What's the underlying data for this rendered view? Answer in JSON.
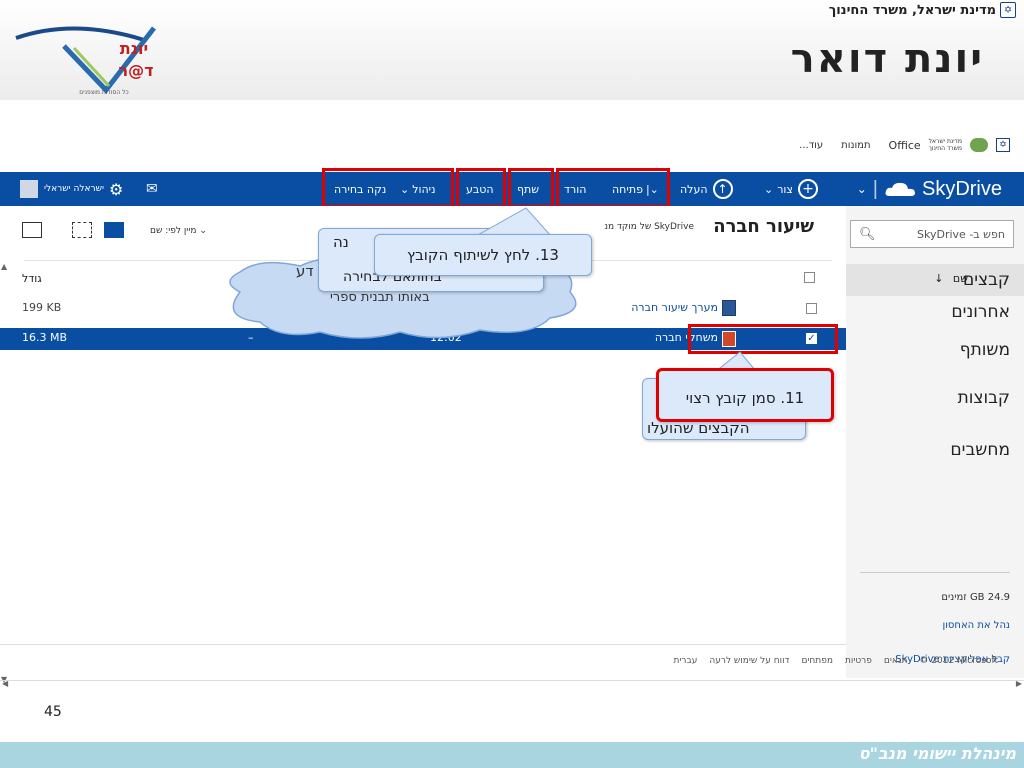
{
  "header": {
    "ministry": "מדינת ישראל, משרד החינוך",
    "title": "יונת דואר",
    "logo_line1": "יונת",
    "logo_line2": "ד@ר",
    "logo_tagline": "כל הסודות מוצפנים"
  },
  "subbar": {
    "mini_ministry_1": "מדינת ישראל",
    "mini_ministry_2": "משרד החינוך",
    "office": "Office",
    "photos": "תמונות",
    "more": "עוד..."
  },
  "topnav": {
    "brand": "SkyDrive",
    "create": "צור",
    "upload": "העלה",
    "open": "פתיחה",
    "download": "הורד",
    "share": "שתף",
    "embed": "הטבע",
    "manage": "ניהול",
    "clear": "נקה בחירה",
    "user": "ישראלה ישראלי"
  },
  "sidebar": {
    "search_placeholder": "חפש ב- SkyDrive",
    "items": [
      {
        "label": "קבצים"
      },
      {
        "label": "אחרונים"
      },
      {
        "label": "משותף"
      },
      {
        "label": "קבוצות"
      },
      {
        "label": "מחשבים"
      }
    ],
    "storage": "24.9 GB זמינים",
    "manage_storage": "נהל את האחסון",
    "get_apps": "קבל אפליקציות SkyDrive"
  },
  "content": {
    "title": "שיעור חברה",
    "subtitle": "SkyDrive של מוקד מנ",
    "sort": "מיין לפי: שם",
    "col_name": "שם",
    "col_size": "גודל",
    "files": [
      {
        "name": "מערך שיעור חברה",
        "size": "199 KB",
        "date": "",
        "sharing": ""
      },
      {
        "name": "משחקי חברה",
        "size": "16.3 MB",
        "date": "12:02",
        "sharing": "–"
      }
    ]
  },
  "footer": {
    "copyright": "© 2012 Microsoft",
    "terms": "תנאים",
    "privacy": "פרטיות",
    "developers": "מפתחים",
    "report": "דווח על שימוש לרעה",
    "language": "עברית"
  },
  "callouts": {
    "c13": "13. לחץ לשיתוף הקובץ",
    "c11": "11. סמן קובץ רצוי",
    "c11_back": "הקבצים שהועלו",
    "back_a": "נה",
    "back_b": "בחותאם לבחירה",
    "cloud_text_1": "דע",
    "cloud_text_2": "באותו תבנית ספרי"
  },
  "slide": {
    "page_number": "45",
    "bottom_text": "מינהלת יישומי מנב\"ס"
  },
  "colors": {
    "brand_blue": "#0a4ea3",
    "highlight_red": "#e00000",
    "callout_fill": "#dbe9fb"
  }
}
